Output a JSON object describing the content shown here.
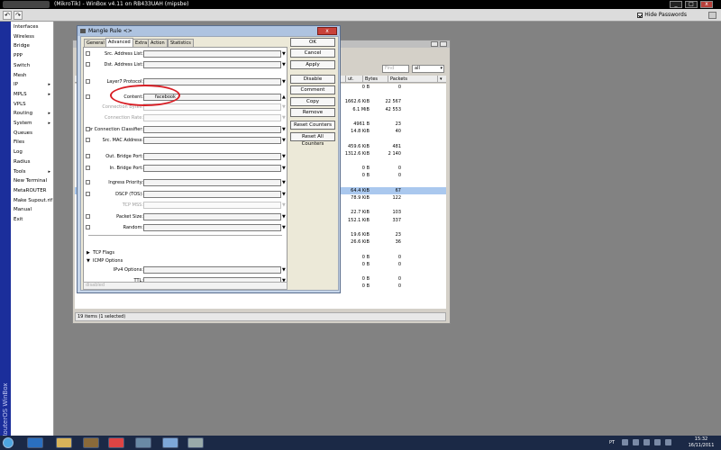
{
  "window": {
    "title": "(MikroTik) - WinBox v4.11 on RB433UAH (mipsbe)",
    "buttons": [
      "_",
      "□",
      "x"
    ]
  },
  "toolbar": {
    "undo_label": "↶",
    "redo_label": "↷",
    "hide_passwords_label": "Hide Passwords"
  },
  "brand": "RouterOS WinBox",
  "menu": {
    "items": [
      {
        "label": "Interfaces",
        "arrow": ""
      },
      {
        "label": "Wireless",
        "arrow": ""
      },
      {
        "label": "Bridge",
        "arrow": ""
      },
      {
        "label": "PPP",
        "arrow": ""
      },
      {
        "label": "Switch",
        "arrow": ""
      },
      {
        "label": "Mesh",
        "arrow": ""
      },
      {
        "label": "IP",
        "arrow": "▸"
      },
      {
        "label": "MPLS",
        "arrow": "▸"
      },
      {
        "label": "VPLS",
        "arrow": ""
      },
      {
        "label": "Routing",
        "arrow": "▸"
      },
      {
        "label": "System",
        "arrow": "▸"
      },
      {
        "label": "Queues",
        "arrow": ""
      },
      {
        "label": "Files",
        "arrow": ""
      },
      {
        "label": "Log",
        "arrow": ""
      },
      {
        "label": "Radius",
        "arrow": ""
      },
      {
        "label": "Tools",
        "arrow": "▸"
      },
      {
        "label": "New Terminal",
        "arrow": ""
      },
      {
        "label": "MetaROUTER",
        "arrow": ""
      },
      {
        "label": "Make Supout.rif",
        "arrow": ""
      },
      {
        "label": "Manual",
        "arrow": ""
      },
      {
        "label": "Exit",
        "arrow": ""
      }
    ]
  },
  "list_window": {
    "find_placeholder": "Find",
    "filter_value": "all",
    "columns": [
      "ut. Int.",
      "Bytes",
      "Packets"
    ],
    "rows": [
      {
        "bytes": "0 B",
        "packets": "0",
        "selected": false
      },
      {
        "bytes": "",
        "packets": "",
        "selected": false
      },
      {
        "bytes": "1662.6 KiB",
        "packets": "22 567",
        "selected": false
      },
      {
        "bytes": "6.1 MiB",
        "packets": "42 553",
        "selected": false
      },
      {
        "bytes": "",
        "packets": "",
        "selected": false
      },
      {
        "bytes": "4961 B",
        "packets": "23",
        "selected": false
      },
      {
        "bytes": "14.8 KiB",
        "packets": "40",
        "selected": false
      },
      {
        "bytes": "",
        "packets": "",
        "selected": false
      },
      {
        "bytes": "459.6 KiB",
        "packets": "481",
        "selected": false
      },
      {
        "bytes": "1312.6 KiB",
        "packets": "2 140",
        "selected": false
      },
      {
        "bytes": "",
        "packets": "",
        "selected": false
      },
      {
        "bytes": "0 B",
        "packets": "0",
        "selected": false
      },
      {
        "bytes": "0 B",
        "packets": "0",
        "selected": false
      },
      {
        "bytes": "",
        "packets": "",
        "selected": false
      },
      {
        "bytes": "64.4 KiB",
        "packets": "67",
        "selected": true
      },
      {
        "bytes": "78.9 KiB",
        "packets": "122",
        "selected": false
      },
      {
        "bytes": "",
        "packets": "",
        "selected": false
      },
      {
        "bytes": "22.7 KiB",
        "packets": "103",
        "selected": false
      },
      {
        "bytes": "152.1 KiB",
        "packets": "337",
        "selected": false
      },
      {
        "bytes": "",
        "packets": "",
        "selected": false
      },
      {
        "bytes": "19.6 KiB",
        "packets": "23",
        "selected": false
      },
      {
        "bytes": "26.6 KiB",
        "packets": "36",
        "selected": false
      },
      {
        "bytes": "",
        "packets": "",
        "selected": false
      },
      {
        "bytes": "0 B",
        "packets": "0",
        "selected": false
      },
      {
        "bytes": "0 B",
        "packets": "0",
        "selected": false
      },
      {
        "bytes": "",
        "packets": "",
        "selected": false
      },
      {
        "bytes": "0 B",
        "packets": "0",
        "selected": false
      },
      {
        "bytes": "0 B",
        "packets": "0",
        "selected": false
      }
    ],
    "status": "19 items (1 selected)"
  },
  "dialog": {
    "title": "Mangle Rule <>",
    "close_label": "x",
    "tabs": [
      "General",
      "Advanced",
      "Extra",
      "Action",
      "Statistics"
    ],
    "active_tab": "Advanced",
    "fields": [
      {
        "label": "Src. Address List:",
        "value": "",
        "dim": false,
        "checkbox": true
      },
      {
        "label": "Dst. Address List:",
        "value": "",
        "dim": false,
        "checkbox": true
      },
      {
        "label": "Layer7 Protocol:",
        "value": "",
        "dim": false,
        "checkbox": true
      },
      {
        "label": "Content:",
        "value": "facebook",
        "dim": false,
        "checkbox": true
      },
      {
        "label": "Connection Bytes:",
        "value": "",
        "dim": true,
        "checkbox": false
      },
      {
        "label": "Connection Rate:",
        "value": "",
        "dim": true,
        "checkbox": false
      },
      {
        "label": "Per Connection Classifier:",
        "value": "",
        "dim": false,
        "checkbox": true
      },
      {
        "label": "Src. MAC Address:",
        "value": "",
        "dim": false,
        "checkbox": true
      },
      {
        "label": "Out. Bridge Port:",
        "value": "",
        "dim": false,
        "checkbox": true
      },
      {
        "label": "In. Bridge Port:",
        "value": "",
        "dim": false,
        "checkbox": true
      },
      {
        "label": "Ingress Priority:",
        "value": "",
        "dim": false,
        "checkbox": true
      },
      {
        "label": "DSCP (TOS):",
        "value": "",
        "dim": false,
        "checkbox": true
      },
      {
        "label": "TCP MSS:",
        "value": "",
        "dim": true,
        "checkbox": false
      },
      {
        "label": "Packet Size:",
        "value": "",
        "dim": false,
        "checkbox": true
      },
      {
        "label": "Random:",
        "value": "",
        "dim": false,
        "checkbox": true
      }
    ],
    "sections": [
      {
        "label": "TCP Flags",
        "collapsed": true
      },
      {
        "label": "ICMP Options",
        "collapsed": false
      }
    ],
    "icmp_fields": [
      {
        "label": "IPv4 Options:",
        "value": ""
      },
      {
        "label": "TTL:",
        "value": ""
      }
    ],
    "status": "disabled",
    "buttons": [
      "OK",
      "Cancel",
      "Apply",
      "Disable",
      "Comment",
      "Copy",
      "Remove",
      "Reset Counters",
      "Reset All Counters"
    ]
  },
  "taskbar": {
    "language": "PT",
    "time": "15:32",
    "date": "16/11/2011"
  },
  "colors": {
    "menu_sidebar": "#1b2e9b",
    "desktop": "#828282",
    "taskbar": "#1b2946",
    "highlight_oval": "#d81f26",
    "selected_row": "#aac8ee"
  }
}
